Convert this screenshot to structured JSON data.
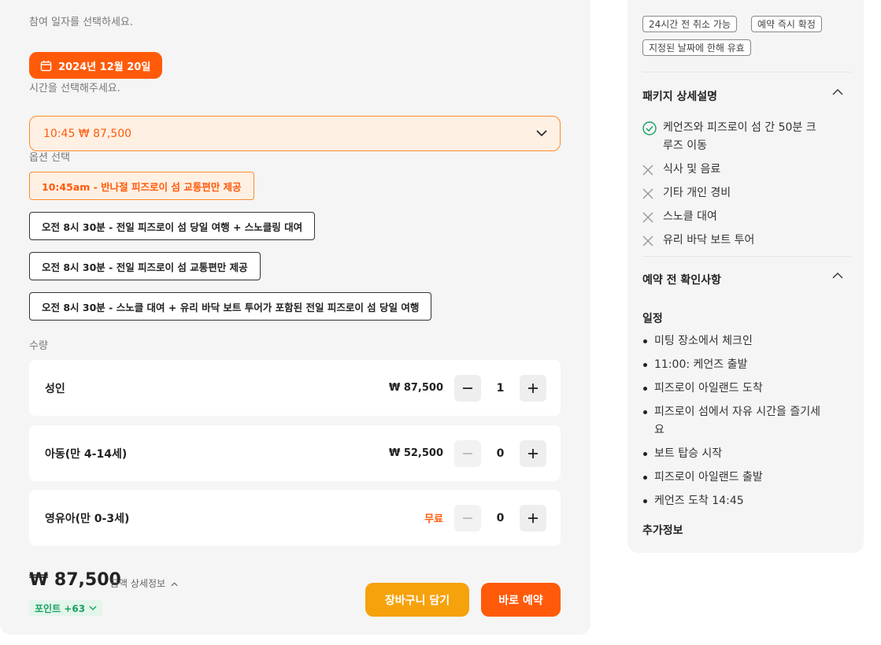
{
  "booking": {
    "date_label": "참여 일자를 선택하세요.",
    "date_value": "2024년 12월 20일",
    "time_label": "시간을 선택해주세요.",
    "time_value": "10:45 ₩ 87,500",
    "option_label": "옵션 선택",
    "options": [
      {
        "label": "10:45am - 반나절 피즈로이 섬 교통편만 제공",
        "selected": true
      },
      {
        "label": "오전 8시 30분 - 전일 피즈로이 섬 당일 여행 + 스노클링 대여",
        "selected": false
      },
      {
        "label": "오전 8시 30분 - 전일 피즈로이 섬 교통편만 제공",
        "selected": false
      },
      {
        "label": "오전 8시 30분 - 스노클 대여 + 유리 바닥 보트 투어가 포함된 전일 피즈로이 섬 당일 여행",
        "selected": false
      }
    ],
    "quantity_label": "수량",
    "quantities": [
      {
        "label": "성인",
        "price": "₩ 87,500",
        "count": "1",
        "minus_enabled": true
      },
      {
        "label": "아동(만 4-14세)",
        "price": "₩ 52,500",
        "count": "0",
        "minus_enabled": false
      },
      {
        "label": "영유아(만 0-3세)",
        "price": "무료",
        "count": "0",
        "minus_enabled": false
      }
    ],
    "total": "₩ 87,500",
    "price_detail": "금액 상세정보",
    "points": "포인트 +63",
    "cart_button": "장바구니 담기",
    "book_button": "바로 예약"
  },
  "info": {
    "tags": [
      "24시간 전 취소 가능",
      "예약 즉시 확정",
      "지정된 날짜에 한해 유효"
    ],
    "package_title": "패키지 상세설명",
    "included": [
      {
        "text_line1": "케언즈와 피즈로이 섬 간 50분 크",
        "text_line2": "루즈 이동",
        "included": true
      },
      {
        "text": "식사 및 음료",
        "included": false
      },
      {
        "text": "기타 개인 경비",
        "included": false
      },
      {
        "text": "스노클 대여",
        "included": false
      },
      {
        "text": "유리 바닥 보트 투어",
        "included": false
      }
    ],
    "notice_title": "예약 전 확인사항",
    "schedule_title": "일정",
    "schedule": [
      "미팅 장소에서 체크인",
      "11:00: 케언즈 출발",
      "피즈로이 아일랜드 도착",
      "피즈로이 섬에서 자유 시간을 즐기세",
      "요",
      "보트 탑승 시작",
      "피즈로이 아일랜드 출발",
      "케언즈 도착 14:45"
    ],
    "extra_title": "추가정보"
  },
  "colors": {
    "accent": "#ff5a0a",
    "cart": "#f6a20d",
    "points_green": "#1aa260",
    "panel_bg": "#f5f5f5"
  }
}
